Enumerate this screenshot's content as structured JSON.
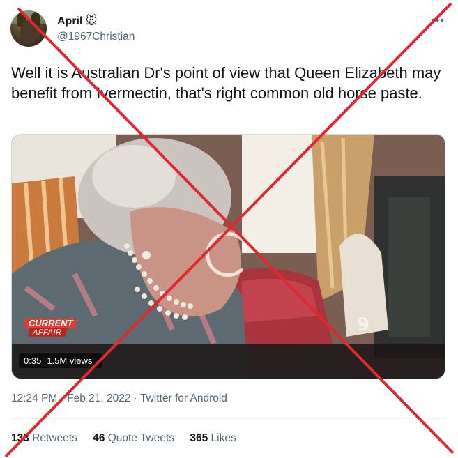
{
  "author": {
    "name": "April",
    "name_emoji": "🐭",
    "handle": "@1967Christian"
  },
  "tweet": {
    "text": "Well it is Australian Dr's point of view that Queen Elizabeth may benefit from Ivermectin, that's right common old horse paste.",
    "time": "12:24 PM",
    "date": "Feb 21, 2022",
    "source": "Twitter for Android",
    "sep": " · "
  },
  "video": {
    "duration": "0:35",
    "views": "1.5M views",
    "broadcaster_logo_line1": "CURRENT",
    "broadcaster_logo_line2": "AFFAIR",
    "channel_logo": "9"
  },
  "stats": {
    "retweets_count": "133",
    "retweets_label": "Retweets",
    "quotes_count": "46",
    "quotes_label": "Quote Tweets",
    "likes_count": "365",
    "likes_label": "Likes"
  },
  "icons": {
    "more": "more-options-icon",
    "overlay": "red-cross-out-overlay"
  },
  "colors": {
    "cross": "#e0282e",
    "secondary_text": "#536471",
    "primary_text": "#0f1419"
  }
}
